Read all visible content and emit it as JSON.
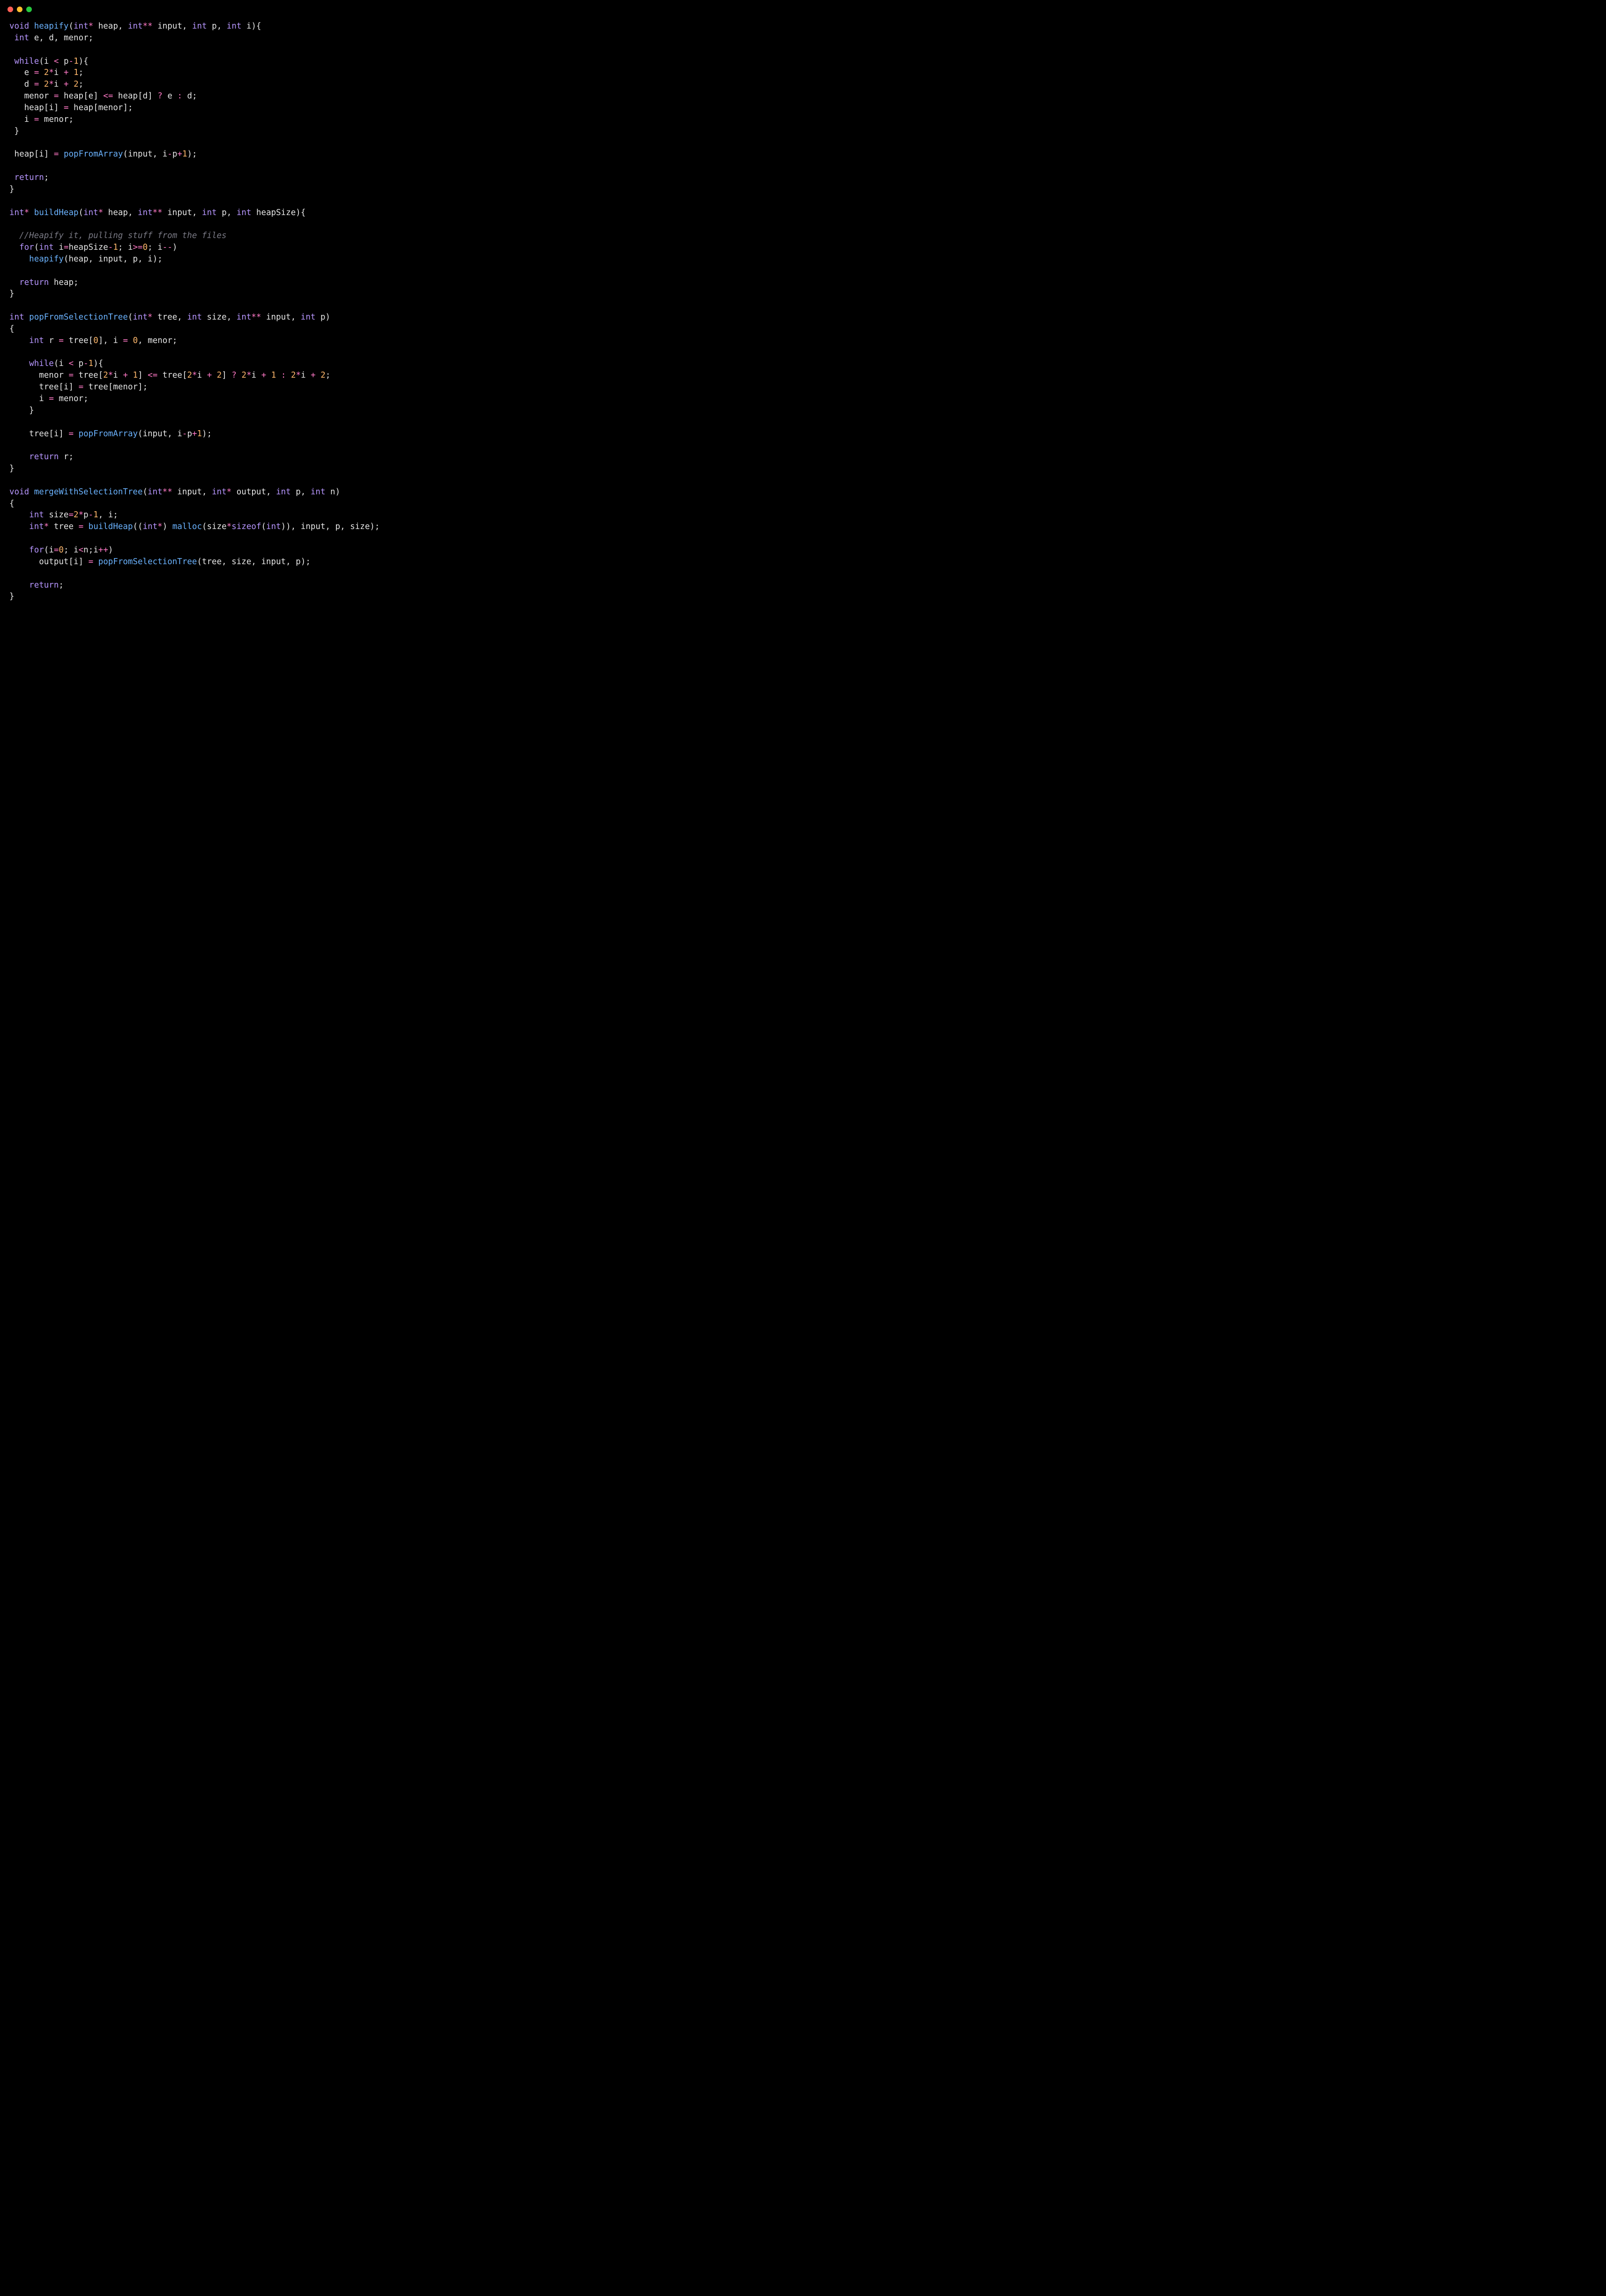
{
  "window": {
    "dots": [
      "red",
      "yellow",
      "green"
    ]
  },
  "code": {
    "functions": [
      {
        "signature": "void heapify(int* heap, int** input, int p, int i){",
        "body": [
          " int e, d, menor;",
          "",
          " while(i < p-1){",
          "   e = 2*i + 1;",
          "   d = 2*i + 2;",
          "   menor = heap[e] <= heap[d] ? e : d;",
          "   heap[i] = heap[menor];",
          "   i = menor;",
          " }",
          "",
          " heap[i] = popFromArray(input, i-p+1);",
          "",
          " return;",
          "}"
        ]
      },
      {
        "signature": "int* buildHeap(int* heap, int** input, int p, int heapSize){",
        "body": [
          "",
          "  //Heapify it, pulling stuff from the files",
          "  for(int i=heapSize-1; i>=0; i--)",
          "    heapify(heap, input, p, i);",
          "",
          "  return heap;",
          "}"
        ]
      },
      {
        "signature": "int popFromSelectionTree(int* tree, int size, int** input, int p)",
        "body": [
          "{",
          "    int r = tree[0], i = 0, menor;",
          "",
          "    while(i < p-1){",
          "      menor = tree[2*i + 1] <= tree[2*i + 2] ? 2*i + 1 : 2*i + 2;",
          "      tree[i] = tree[menor];",
          "      i = menor;",
          "    }",
          "",
          "    tree[i] = popFromArray(input, i-p+1);",
          "",
          "    return r;",
          "}"
        ]
      },
      {
        "signature": "void mergeWithSelectionTree(int** input, int* output, int p, int n)",
        "body": [
          "{",
          "    int size=2*p-1, i;",
          "    int* tree = buildHeap((int*) malloc(size*sizeof(int)), input, p, size);",
          "",
          "    for(i=0; i<n;i++)",
          "      output[i] = popFromSelectionTree(tree, size, input, p);",
          "",
          "    return;",
          "}"
        ]
      }
    ]
  }
}
